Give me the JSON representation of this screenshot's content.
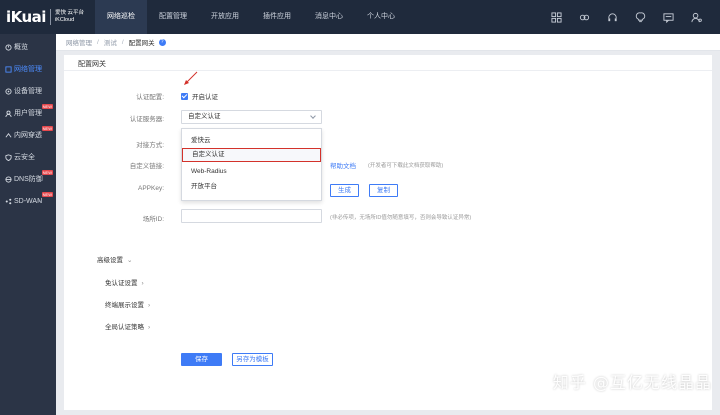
{
  "logo": {
    "main": "iKuai",
    "sub1": "爱快 云平台",
    "sub2": "iKCloud"
  },
  "topnav": [
    {
      "label": "网络巡检",
      "active": true
    },
    {
      "label": "配置管理"
    },
    {
      "label": "开放应用"
    },
    {
      "label": "插件应用"
    },
    {
      "label": "消息中心"
    },
    {
      "label": "个人中心"
    }
  ],
  "topicons": [
    "grid-icon",
    "link-icon",
    "headset-icon",
    "bulb-icon",
    "message-icon",
    "user-settings-icon"
  ],
  "sidebar": {
    "items": [
      {
        "label": "概览",
        "icon": "overview-icon"
      },
      {
        "label": "网络管理",
        "icon": "network-icon",
        "active": true
      },
      {
        "label": "设备管理",
        "icon": "device-icon",
        "caret": "⌄"
      },
      {
        "label": "用户管理",
        "icon": "user-icon",
        "badge": "NEW"
      },
      {
        "label": "内网穿透",
        "icon": "tunnel-icon",
        "badge": "NEW"
      },
      {
        "label": "云安全",
        "icon": "shield-icon"
      },
      {
        "label": "DNS防御",
        "icon": "dns-icon",
        "badge": "NEW"
      },
      {
        "label": "SD-WAN",
        "icon": "sdwan-icon",
        "badge": "NEW",
        "caret": "⌄"
      }
    ]
  },
  "breadcrumb": {
    "items": [
      "网络管理",
      "测试",
      "配置网关"
    ],
    "sep": "/",
    "help": "?"
  },
  "form": {
    "section_title": "配置网关",
    "auth_config_label": "认证配置:",
    "auth_enable_label": "开启认证",
    "auth_server_label": "认证服务器:",
    "auth_server_value": "自定义认证",
    "dropdown_options": [
      "爱快云",
      "自定义认证",
      "Web-Radius",
      "开放平台"
    ],
    "dock_method_label": "对接方式:",
    "custom_link_label": "自定义链接:",
    "help_doc": "帮助文档",
    "help_hint": "(开发者可下载此文档获取帮助)",
    "appkey_label": "APPKey:",
    "generate_btn": "生成",
    "copy_btn": "复制",
    "scene_id_label": "场所ID:",
    "scene_hint": "(非必传项，无场所ID值勿随意填写，否则会导致认证异常)",
    "advanced_label": "高级设置",
    "advanced_caret": "⌄",
    "adv_items": [
      "免认证设置",
      "终端展示设置",
      "全局认证策略"
    ],
    "adv_chevron": "›",
    "save_btn": "保存",
    "save_template_btn": "另存为模板"
  },
  "watermark": "知乎 @互亿无线晶晶",
  "colors": {
    "accent": "#3e7bf6",
    "highlight": "#d3322b",
    "topbar": "#1f2a3c",
    "sidebar": "#2b3446"
  }
}
